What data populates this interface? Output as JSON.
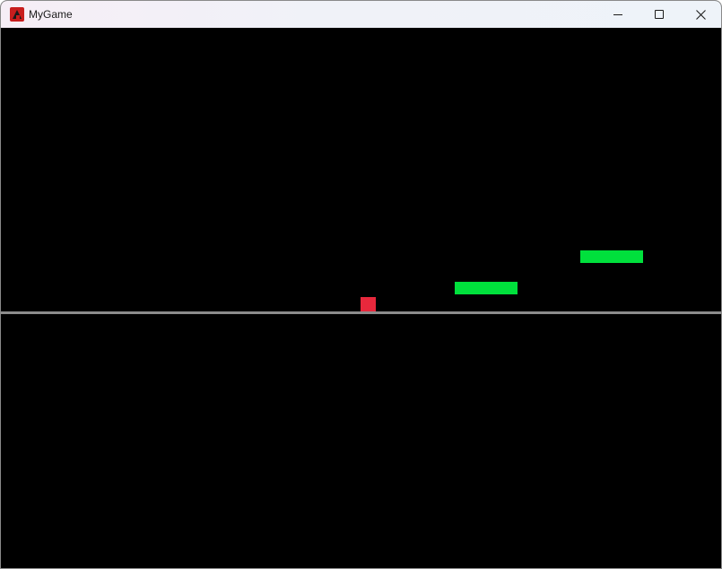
{
  "window": {
    "title": "MyGame",
    "controls": {
      "minimize_icon": "minimize-icon",
      "maximize_icon": "maximize-icon",
      "close_icon": "close-icon",
      "close_glyph": "✕"
    }
  },
  "game": {
    "background_color": "#000000",
    "ground_color": "#8c8c8c",
    "player_color": "#e8283c",
    "platform_color": "#00e03c"
  }
}
